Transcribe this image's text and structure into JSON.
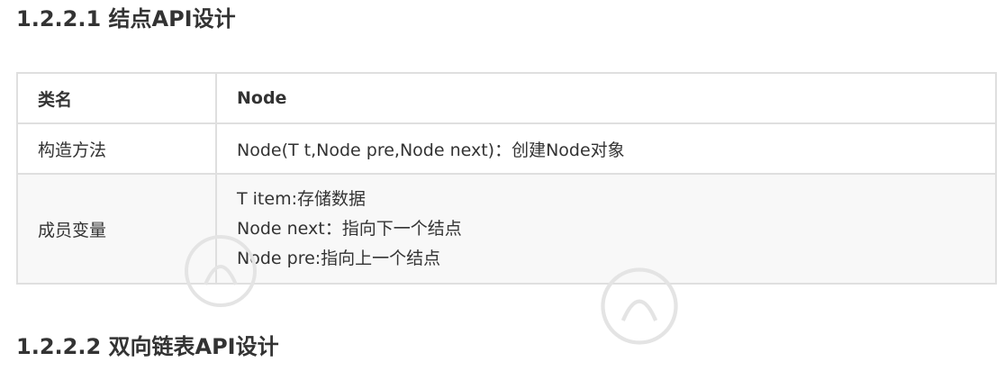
{
  "section1": {
    "heading": "1.2.2.1 结点API设计"
  },
  "table": {
    "header": {
      "label": "类名",
      "value": "Node"
    },
    "constructor_row": {
      "label": "构造方法",
      "value": "Node(T t,Node pre,Node next)：创建Node对象"
    },
    "fields_row": {
      "label": "成员变量",
      "lines": [
        "T item:存储数据",
        "Node next：指向下一个结点",
        "Node pre:指向上一个结点"
      ]
    }
  },
  "section2": {
    "heading": "1.2.2.2  双向链表API设计"
  },
  "watermark": {
    "icon": "heima-logo-icon",
    "color": "#d0d0d0"
  }
}
